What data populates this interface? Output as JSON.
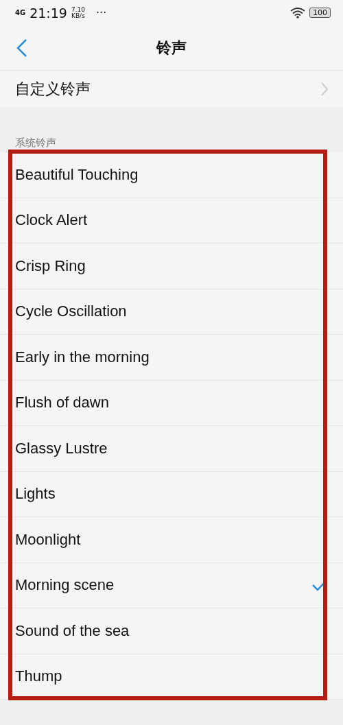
{
  "status_bar": {
    "network": "4G",
    "time": "21:19",
    "speed": "7.10",
    "speed_unit": "KB/s",
    "more": "···",
    "battery": "100"
  },
  "header": {
    "title": "铃声"
  },
  "custom_item": {
    "label": "自定义铃声"
  },
  "section": {
    "label": "系统铃声"
  },
  "ringtones": [
    {
      "name": "Beautiful Touching",
      "selected": false
    },
    {
      "name": "Clock Alert",
      "selected": false
    },
    {
      "name": "Crisp Ring",
      "selected": false
    },
    {
      "name": "Cycle Oscillation",
      "selected": false
    },
    {
      "name": "Early in the morning",
      "selected": false
    },
    {
      "name": "Flush of dawn",
      "selected": false
    },
    {
      "name": "Glassy Lustre",
      "selected": false
    },
    {
      "name": "Lights",
      "selected": false
    },
    {
      "name": "Moonlight",
      "selected": false
    },
    {
      "name": "Morning scene",
      "selected": true
    },
    {
      "name": "Sound of the sea",
      "selected": false
    },
    {
      "name": "Thump",
      "selected": false
    }
  ]
}
